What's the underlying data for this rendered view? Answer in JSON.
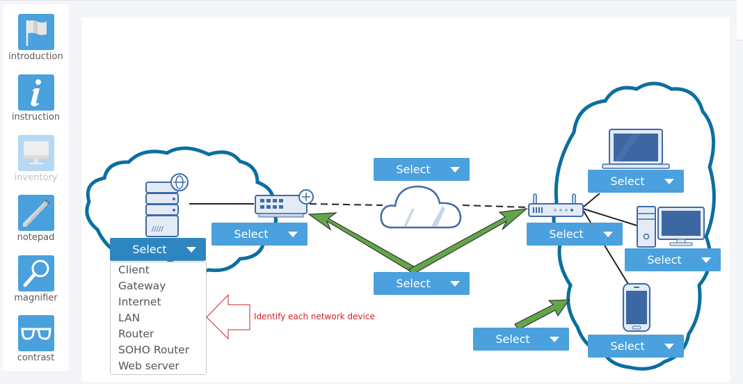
{
  "sidebar": {
    "tools": [
      {
        "label": "introduction",
        "icon": "flag-icon",
        "enabled": true
      },
      {
        "label": "instruction",
        "icon": "info-icon",
        "enabled": true
      },
      {
        "label": "inventory",
        "icon": "monitor-icon",
        "enabled": false
      },
      {
        "label": "notepad",
        "icon": "pencil-icon",
        "enabled": true
      },
      {
        "label": "magnifier",
        "icon": "magnifier-icon",
        "enabled": true
      },
      {
        "label": "contrast",
        "icon": "glasses-icon",
        "enabled": true
      }
    ]
  },
  "diagram": {
    "selects": {
      "web_server": "Select",
      "router": "Select",
      "internet": "Select",
      "connection": "Select",
      "soho_router": "Select",
      "laptop": "Select",
      "desktop": "Select",
      "lan": "Select",
      "phone": "Select"
    },
    "open_dropdown": {
      "options": [
        "Client",
        "Gateway",
        "Internet",
        "LAN",
        "Router",
        "SOHO Router",
        "Web server"
      ]
    },
    "annotation": "Identify each network device",
    "colors": {
      "select_bg": "#4aa1dd",
      "select_open_bg": "#2e86c1",
      "cloud_outline": "#0b6fa0",
      "arrow_fill": "#63a64a",
      "annotation": "#d3202a"
    }
  }
}
